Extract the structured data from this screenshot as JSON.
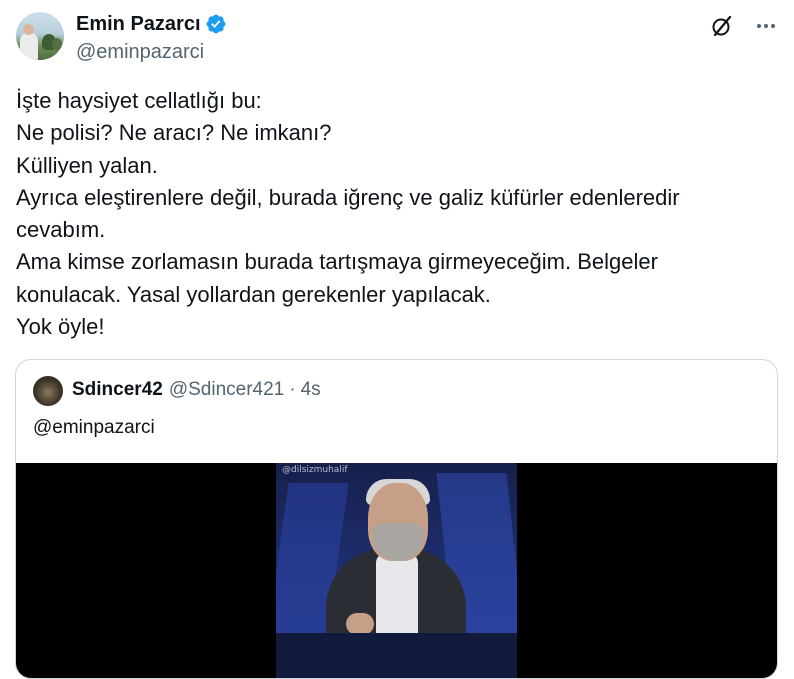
{
  "tweet": {
    "author_name": "Emin Pazarcı",
    "author_handle": "@eminpazarci",
    "text_lines": [
      "İşte haysiyet cellatlığı bu:",
      "Ne polisi? Ne aracı? Ne imkanı?",
      "Külliyen yalan.",
      "Ayrıca eleştirenlere değil, burada iğrenç ve galiz küfürler edenleredir",
      "cevabım.",
      "Ama kimse zorlamasın burada tartışmaya girmeyeceğim. Belgeler",
      "konulacak. Yasal yollardan gerekenler yapılacak.",
      "Yok öyle!"
    ],
    "icons": {
      "verified": "verified-badge-icon",
      "grok": "grok-icon",
      "more": "more-options-icon"
    },
    "colors": {
      "verified": "#1d9bf0",
      "secondary_text": "#536471",
      "border": "#cfd9de"
    }
  },
  "quoted_tweet": {
    "author_name": "Sdincer42",
    "author_handle": "@Sdincer421",
    "separator": "·",
    "time": "4s",
    "text": "@eminpazarci",
    "video_watermark": "@dilsizmuhalif"
  }
}
